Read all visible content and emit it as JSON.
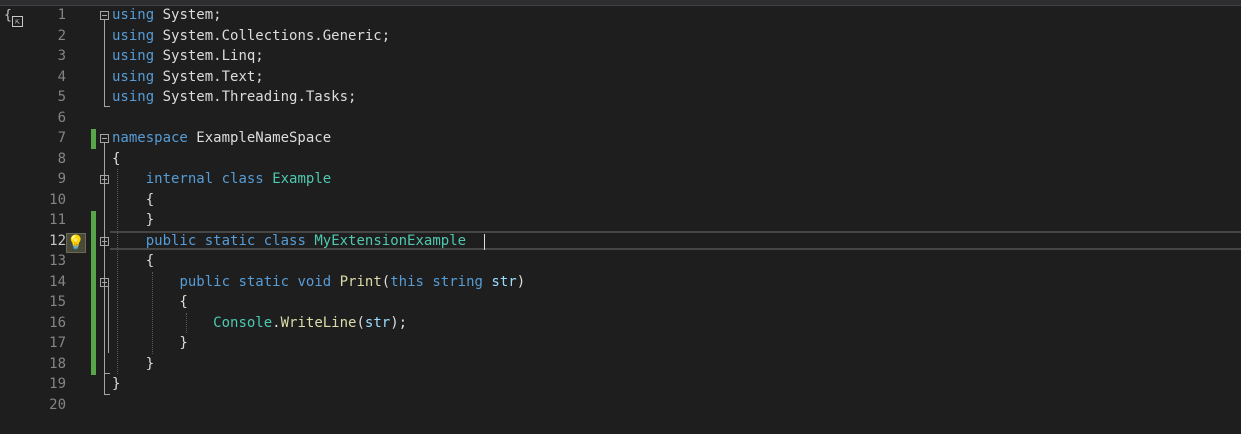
{
  "editor": {
    "current_line": "12",
    "lines": [
      {
        "num": "1",
        "tokens": [
          {
            "t": "using",
            "c": "kw"
          },
          {
            "t": " System;",
            "c": "tx"
          }
        ]
      },
      {
        "num": "2",
        "tokens": [
          {
            "t": "using",
            "c": "kw"
          },
          {
            "t": " System.Collections.Generic;",
            "c": "tx"
          }
        ]
      },
      {
        "num": "3",
        "tokens": [
          {
            "t": "using",
            "c": "kw"
          },
          {
            "t": " System.Linq;",
            "c": "tx"
          }
        ]
      },
      {
        "num": "4",
        "tokens": [
          {
            "t": "using",
            "c": "kw"
          },
          {
            "t": " System.Text;",
            "c": "tx"
          }
        ]
      },
      {
        "num": "5",
        "tokens": [
          {
            "t": "using",
            "c": "kw"
          },
          {
            "t": " System.Threading.Tasks;",
            "c": "tx"
          }
        ]
      },
      {
        "num": "6",
        "tokens": []
      },
      {
        "num": "7",
        "tokens": [
          {
            "t": "namespace",
            "c": "kw"
          },
          {
            "t": " ExampleNameSpace",
            "c": "tx"
          }
        ]
      },
      {
        "num": "8",
        "tokens": [
          {
            "t": "{",
            "c": "tx"
          }
        ]
      },
      {
        "num": "9",
        "tokens": [
          {
            "t": "    ",
            "c": "tx"
          },
          {
            "t": "internal",
            "c": "kw"
          },
          {
            "t": " ",
            "c": "tx"
          },
          {
            "t": "class",
            "c": "kw"
          },
          {
            "t": " ",
            "c": "tx"
          },
          {
            "t": "Example",
            "c": "ty"
          }
        ]
      },
      {
        "num": "10",
        "tokens": [
          {
            "t": "    {",
            "c": "tx"
          }
        ]
      },
      {
        "num": "11",
        "tokens": [
          {
            "t": "    }",
            "c": "tx"
          }
        ]
      },
      {
        "num": "12",
        "tokens": [
          {
            "t": "    ",
            "c": "tx"
          },
          {
            "t": "public",
            "c": "kw"
          },
          {
            "t": " ",
            "c": "tx"
          },
          {
            "t": "static",
            "c": "kw"
          },
          {
            "t": " ",
            "c": "tx"
          },
          {
            "t": "class",
            "c": "kw"
          },
          {
            "t": " ",
            "c": "tx"
          },
          {
            "t": "MyExtensionExample",
            "c": "ty"
          }
        ]
      },
      {
        "num": "13",
        "tokens": [
          {
            "t": "    {",
            "c": "tx"
          }
        ]
      },
      {
        "num": "14",
        "tokens": [
          {
            "t": "        ",
            "c": "tx"
          },
          {
            "t": "public",
            "c": "kw"
          },
          {
            "t": " ",
            "c": "tx"
          },
          {
            "t": "static",
            "c": "kw"
          },
          {
            "t": " ",
            "c": "tx"
          },
          {
            "t": "void",
            "c": "kw"
          },
          {
            "t": " ",
            "c": "tx"
          },
          {
            "t": "Print",
            "c": "mt"
          },
          {
            "t": "(",
            "c": "tx"
          },
          {
            "t": "this",
            "c": "kw"
          },
          {
            "t": " ",
            "c": "tx"
          },
          {
            "t": "string",
            "c": "kw"
          },
          {
            "t": " ",
            "c": "tx"
          },
          {
            "t": "str",
            "c": "id"
          },
          {
            "t": ")",
            "c": "tx"
          }
        ]
      },
      {
        "num": "15",
        "tokens": [
          {
            "t": "        {",
            "c": "tx"
          }
        ]
      },
      {
        "num": "16",
        "tokens": [
          {
            "t": "            ",
            "c": "tx"
          },
          {
            "t": "Console",
            "c": "ty"
          },
          {
            "t": ".",
            "c": "tx"
          },
          {
            "t": "WriteLine",
            "c": "mt"
          },
          {
            "t": "(",
            "c": "tx"
          },
          {
            "t": "str",
            "c": "id"
          },
          {
            "t": ");",
            "c": "tx"
          }
        ]
      },
      {
        "num": "17",
        "tokens": [
          {
            "t": "        }",
            "c": "tx"
          }
        ]
      },
      {
        "num": "18",
        "tokens": [
          {
            "t": "    }",
            "c": "tx"
          }
        ]
      },
      {
        "num": "19",
        "tokens": [
          {
            "t": "}",
            "c": "tx"
          }
        ]
      },
      {
        "num": "20",
        "tokens": []
      }
    ]
  },
  "icons": {
    "quick_actions": "lightbulb-icon",
    "namespace_scope": "braces-icon"
  },
  "colors": {
    "background": "#1e1e1e",
    "keyword": "#569cd6",
    "type": "#4ec9b0",
    "method": "#dcdcaa",
    "identifier": "#9cdcfe",
    "text": "#dcdcdc",
    "change_bar": "#57a64a"
  }
}
